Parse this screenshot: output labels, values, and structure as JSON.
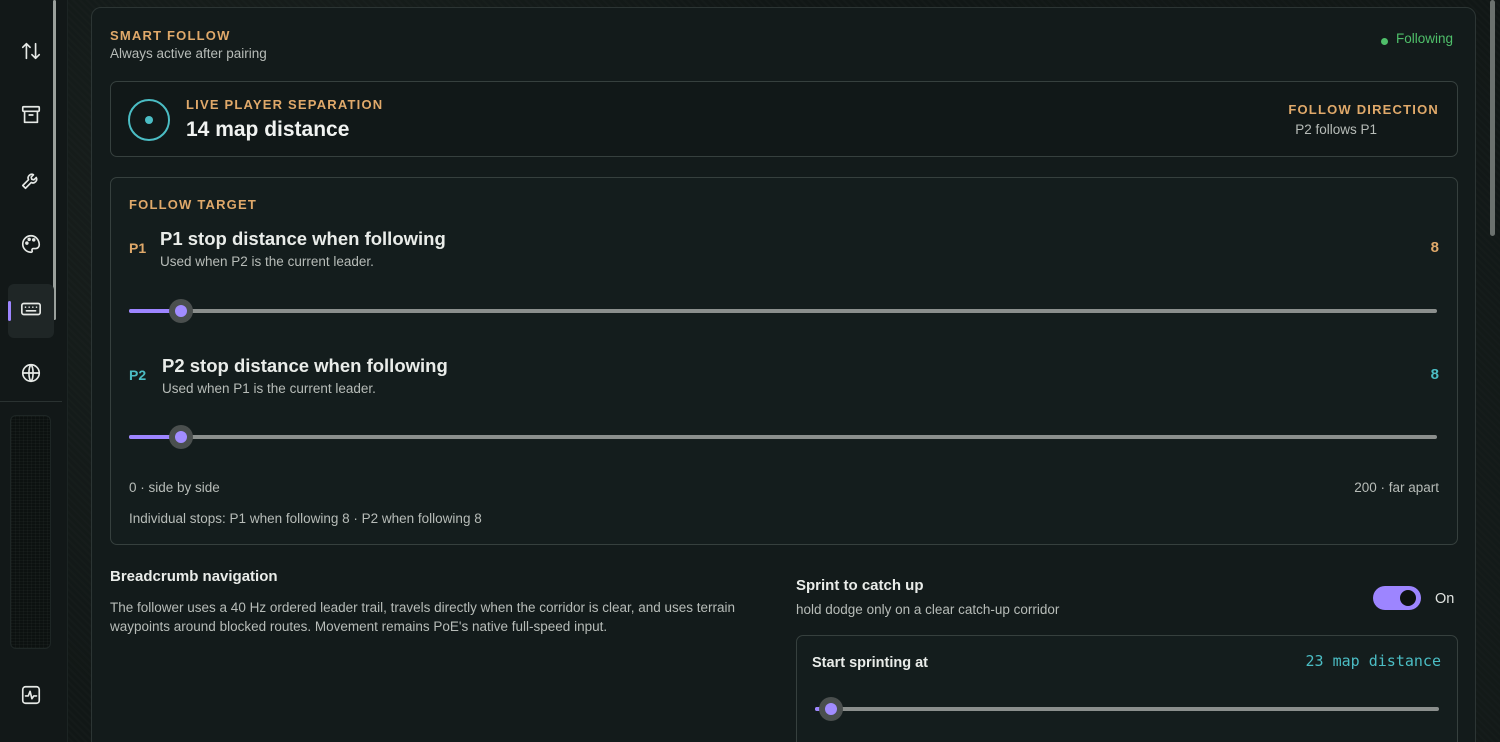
{
  "sidebar": {
    "items": [
      {
        "icon": "arrows-up-down-icon"
      },
      {
        "icon": "archive-icon"
      },
      {
        "icon": "wrench-icon"
      },
      {
        "icon": "palette-icon"
      },
      {
        "icon": "keyboard-icon",
        "active": true
      },
      {
        "icon": "globe-icon"
      },
      {
        "icon": "activity-icon"
      }
    ]
  },
  "smart_follow": {
    "title": "SMART FOLLOW",
    "subtitle": "Always active after pairing",
    "status": "Following"
  },
  "separation": {
    "label": "LIVE PLAYER SEPARATION",
    "value": "14 map distance",
    "direction_label": "FOLLOW DIRECTION",
    "direction_value": "P2 follows P1"
  },
  "follow_target": {
    "label": "FOLLOW TARGET",
    "p1": {
      "tag": "P1",
      "title": "P1 stop distance when following",
      "subtitle": "Used when P2 is the current leader.",
      "value": "8",
      "fraction": 0.04
    },
    "p2": {
      "tag": "P2",
      "title": "P2 stop distance when following",
      "subtitle": "Used when P1 is the current leader.",
      "value": "8",
      "fraction": 0.04
    },
    "range_min": "0 · side by side",
    "range_max": "200 · far apart",
    "individual": "Individual stops: P1 when following 8 · P2 when following 8"
  },
  "breadcrumb": {
    "title": "Breadcrumb navigation",
    "text": "The follower uses a 40 Hz ordered leader trail, travels directly when the corridor is clear, and uses terrain waypoints around blocked routes. Movement remains PoE's native full-speed input."
  },
  "sprint": {
    "title": "Sprint to catch up",
    "subtitle": "hold dodge only on a clear catch-up corridor",
    "toggle_label": "On",
    "start_label": "Start sprinting at",
    "start_value": "23 map distance",
    "fraction": 0.025
  },
  "colors": {
    "accent": "#9d85ff",
    "p1": "#e0a96a",
    "p2": "#4bbdc4",
    "status": "#4fbf6a"
  }
}
